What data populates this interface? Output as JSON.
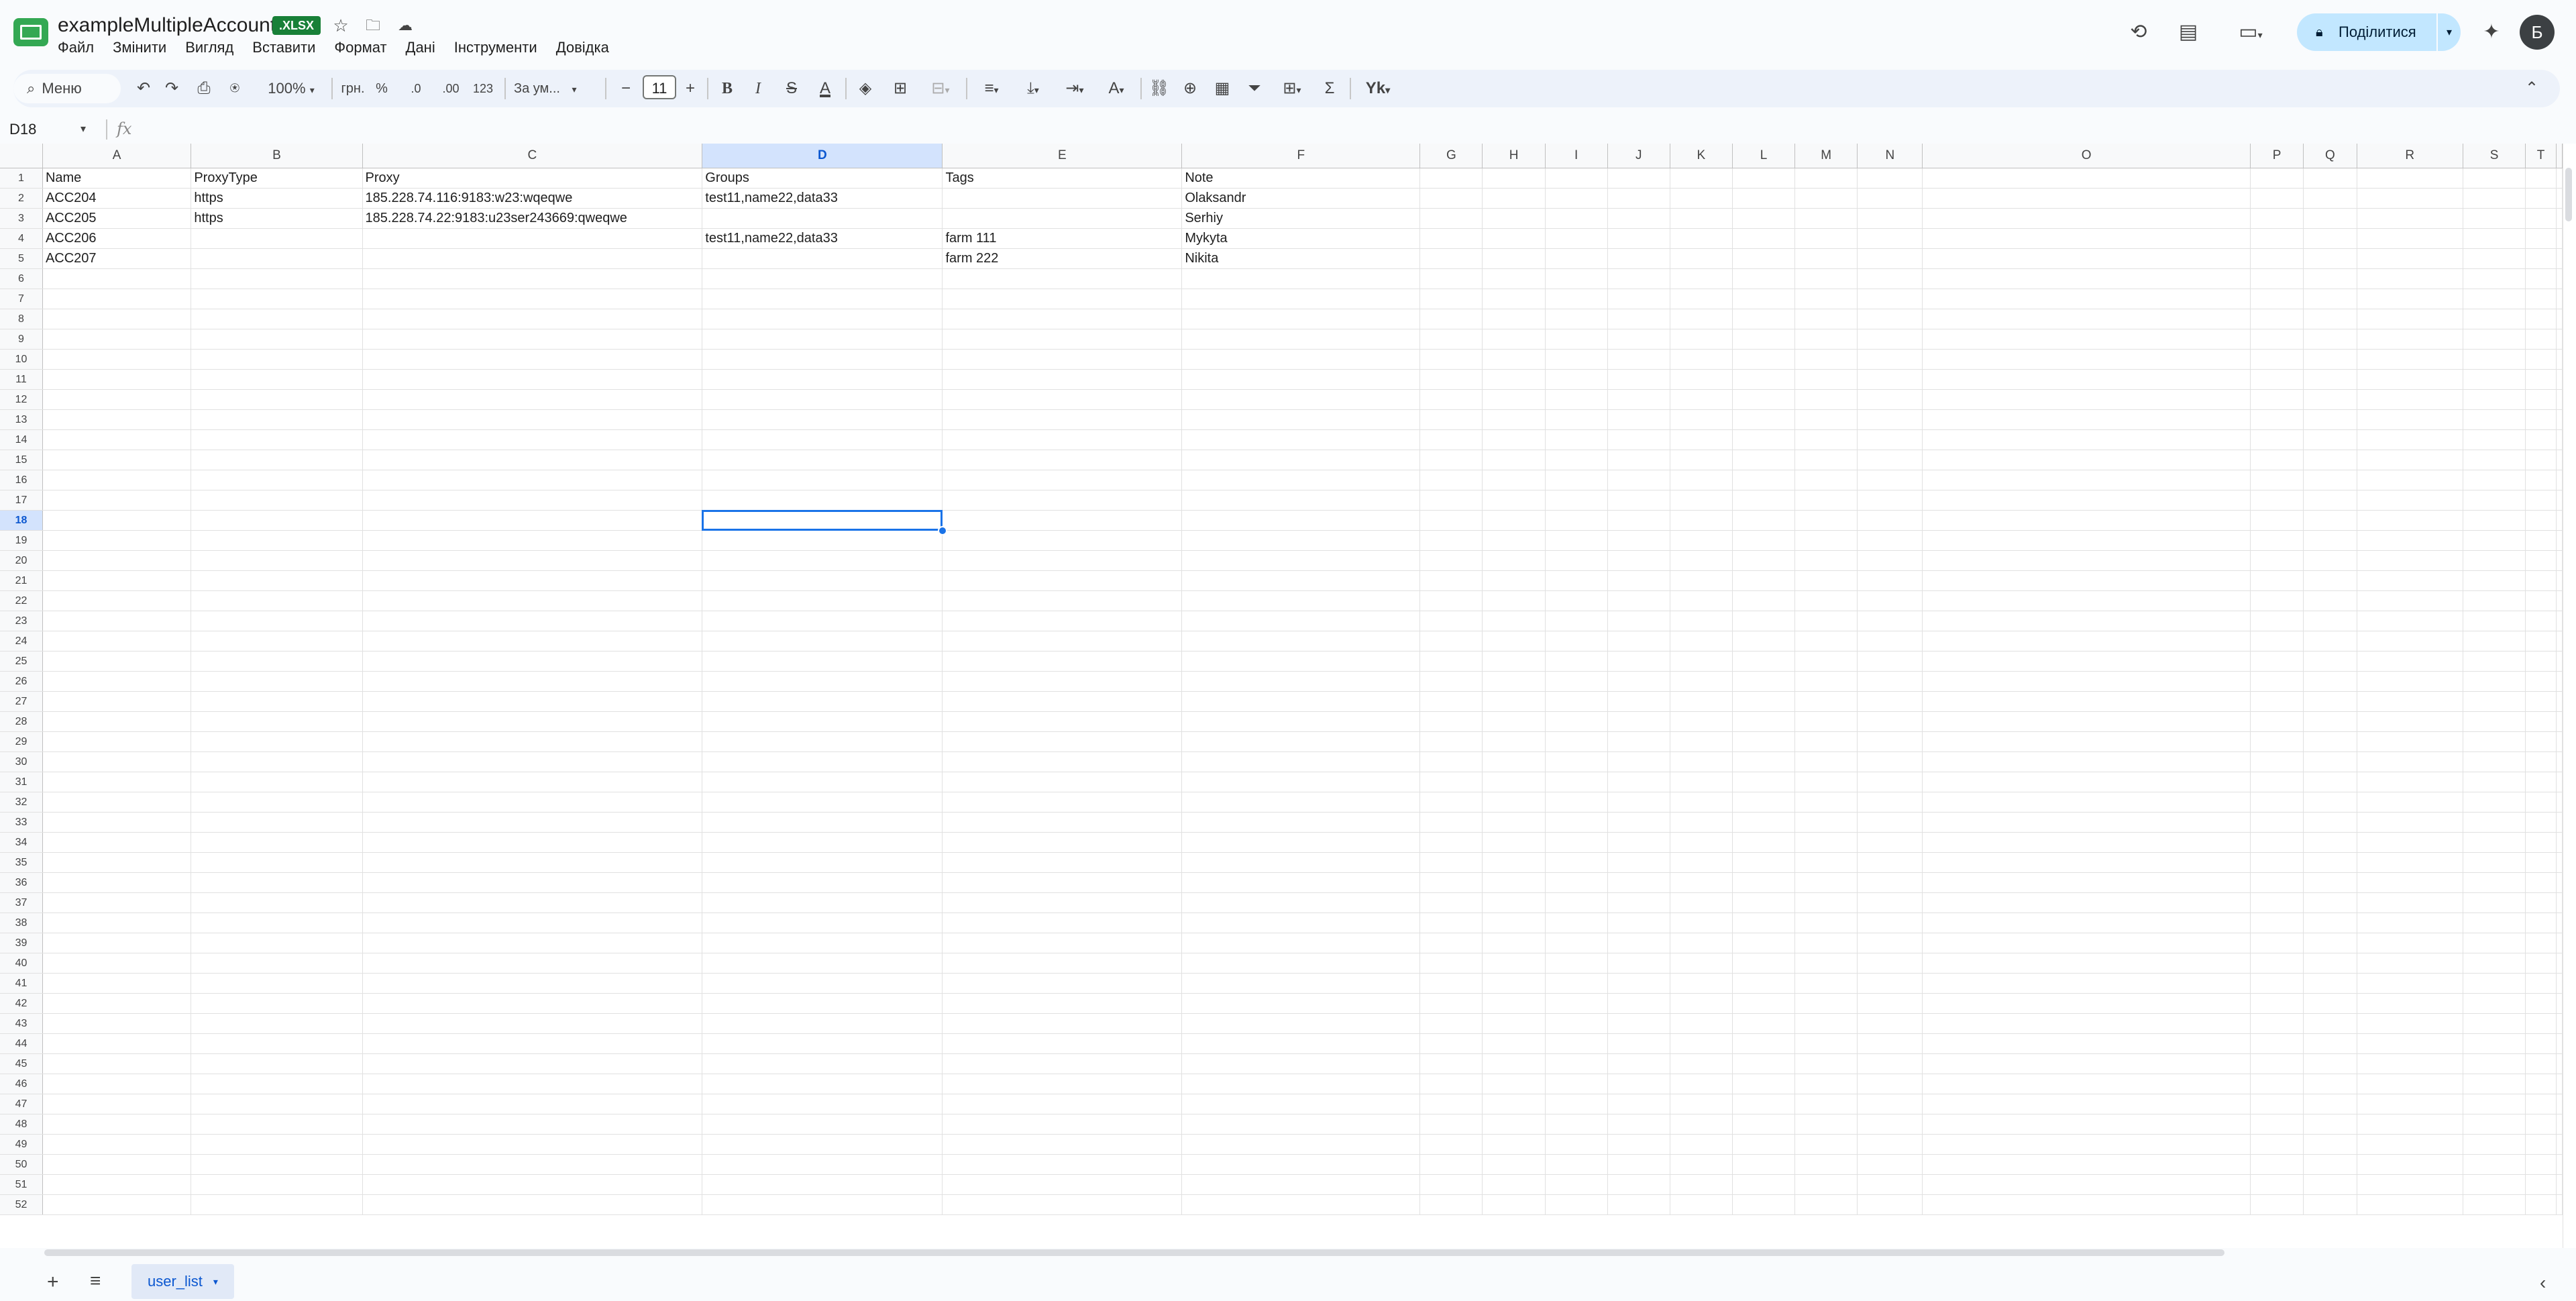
{
  "doc": {
    "title": "exampleMultipleAccount",
    "badge": ".XLSX"
  },
  "menu": [
    "Файл",
    "Змінити",
    "Вигляд",
    "Вставити",
    "Формат",
    "Дані",
    "Інструменти",
    "Довідка"
  ],
  "share": {
    "label": "Поділитися"
  },
  "avatar": {
    "initial": "Б"
  },
  "toolbar": {
    "search_label": "Меню",
    "zoom": "100%",
    "currency": "грн.",
    "percent": "%",
    "dec_decrease": ".0",
    "dec_increase": ".00",
    "number_format": "123",
    "font_name": "За ум...",
    "font_size": "11"
  },
  "formula_bar": {
    "cell_ref": "D18",
    "fx": "fx",
    "value": ""
  },
  "sheet": {
    "columns": [
      "A",
      "B",
      "C",
      "D",
      "E",
      "F",
      "G",
      "H",
      "I",
      "J",
      "K",
      "L",
      "M",
      "N",
      "O",
      "P",
      "Q",
      "R",
      "S",
      "T"
    ],
    "selected_cell": "D18",
    "rows": [
      [
        "Name",
        "ProxyType",
        "Proxy",
        "Groups",
        "Tags",
        "Note"
      ],
      [
        "ACC204",
        "https",
        "185.228.74.116:9183:w23:wqeqwe",
        "test11,name22,data33",
        "",
        "Olaksandr"
      ],
      [
        "ACC205",
        "https",
        "185.228.74.22:9183:u23ser243669:qweqwe",
        "",
        "",
        "Serhiy"
      ],
      [
        "ACC206",
        "",
        "",
        "test11,name22,data33",
        "farm 111",
        "Mykyta"
      ],
      [
        "ACC207",
        "",
        "",
        "",
        "farm 222",
        "Nikita"
      ]
    ],
    "row_count": 52
  },
  "tabs": [
    {
      "label": "user_list",
      "active": true
    }
  ]
}
